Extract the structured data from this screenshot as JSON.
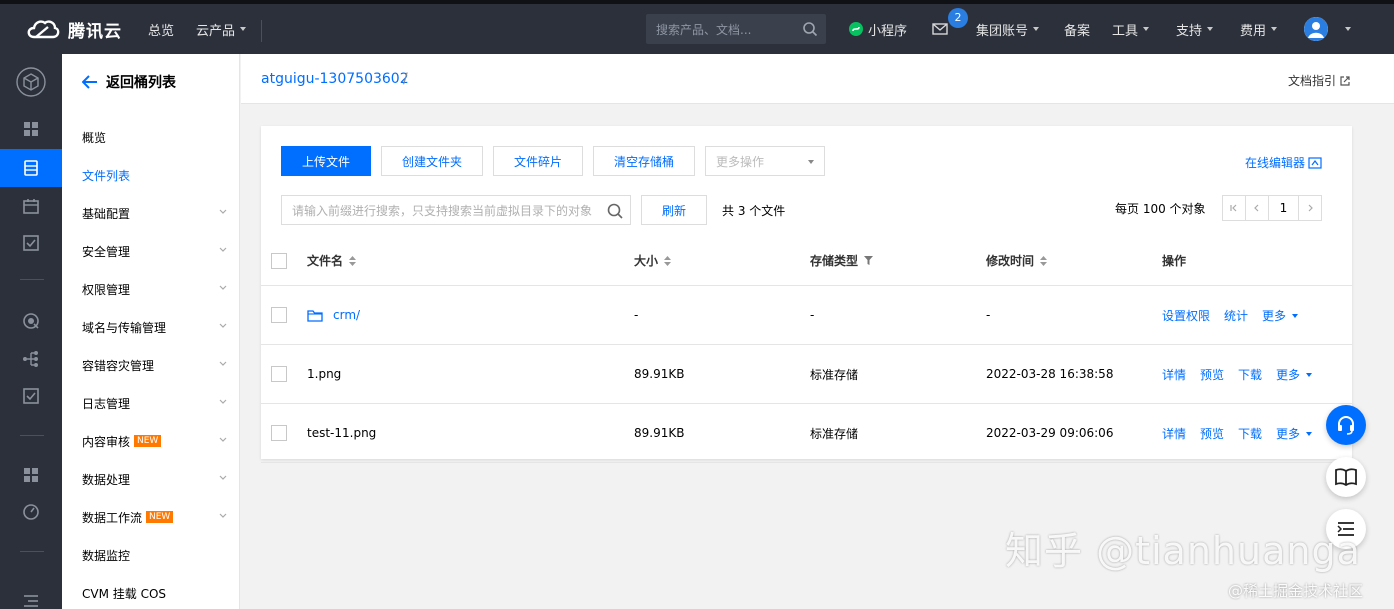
{
  "header": {
    "brand": "腾讯云",
    "nav": [
      {
        "label": "总览",
        "has_caret": false
      },
      {
        "label": "云产品",
        "has_caret": true
      }
    ],
    "search_placeholder": "搜索产品、文档...",
    "mini_program": "小程序",
    "mail_count": "2",
    "right_nav": [
      {
        "label": "集团账号",
        "has_caret": true
      },
      {
        "label": "备案",
        "has_caret": false
      },
      {
        "label": "工具",
        "has_caret": true
      },
      {
        "label": "支持",
        "has_caret": true
      },
      {
        "label": "费用",
        "has_caret": true
      }
    ]
  },
  "rail": {
    "icons": [
      "cube-icon",
      "grid-icon",
      "storage-icon",
      "calendar-icon",
      "checklist-icon",
      "security-icon",
      "tree-icon",
      "check-square-icon",
      "dashboard-icon",
      "gauge-icon",
      "menu-icon"
    ],
    "active": "storage-icon"
  },
  "subnav": {
    "back_label": "返回桶列表",
    "items": [
      {
        "label": "概览",
        "active": false,
        "expandable": false,
        "new": false
      },
      {
        "label": "文件列表",
        "active": true,
        "expandable": false,
        "new": false
      },
      {
        "label": "基础配置",
        "active": false,
        "expandable": true,
        "new": false
      },
      {
        "label": "安全管理",
        "active": false,
        "expandable": true,
        "new": false
      },
      {
        "label": "权限管理",
        "active": false,
        "expandable": true,
        "new": false
      },
      {
        "label": "域名与传输管理",
        "active": false,
        "expandable": true,
        "new": false
      },
      {
        "label": "容错容灾管理",
        "active": false,
        "expandable": true,
        "new": false
      },
      {
        "label": "日志管理",
        "active": false,
        "expandable": true,
        "new": false
      },
      {
        "label": "内容审核",
        "active": false,
        "expandable": true,
        "new": true
      },
      {
        "label": "数据处理",
        "active": false,
        "expandable": true,
        "new": false
      },
      {
        "label": "数据工作流",
        "active": false,
        "expandable": true,
        "new": true
      },
      {
        "label": "数据监控",
        "active": false,
        "expandable": false,
        "new": false
      },
      {
        "label": "CVM 挂载 COS",
        "active": false,
        "expandable": false,
        "new": false
      }
    ],
    "new_tag": "NEW"
  },
  "breadcrumb": {
    "bucket": "atguigu-1307503602",
    "separator": "/",
    "doc_link": "文档指引"
  },
  "toolbar": {
    "upload": "上传文件",
    "create_folder": "创建文件夹",
    "fragments": "文件碎片",
    "clear_bucket": "清空存储桶",
    "more_ops": "更多操作",
    "online_editor": "在线编辑器",
    "search_placeholder": "请输入前缀进行搜索，只支持搜索当前虚拟目录下的对象",
    "refresh": "刷新",
    "file_count": "共 3 个文件",
    "per_page": "每页 100 个对象",
    "page": "1"
  },
  "table": {
    "columns": {
      "name": "文件名",
      "size": "大小",
      "storage": "存储类型",
      "modified": "修改时间",
      "actions": "操作"
    },
    "rows": [
      {
        "name": "crm/",
        "is_folder": true,
        "size": "-",
        "storage": "-",
        "modified": "-",
        "actions": [
          "设置权限",
          "统计",
          "更多"
        ]
      },
      {
        "name": "1.png",
        "is_folder": false,
        "size": "89.91KB",
        "storage": "标准存储",
        "modified": "2022-03-28 16:38:58",
        "actions": [
          "详情",
          "预览",
          "下载",
          "更多"
        ]
      },
      {
        "name": "test-11.png",
        "is_folder": false,
        "size": "89.91KB",
        "storage": "标准存储",
        "modified": "2022-03-29 09:06:06",
        "actions": [
          "详情",
          "预览",
          "下载",
          "更多"
        ]
      }
    ]
  },
  "watermarks": {
    "zhihu": "知乎 @tianhuanga",
    "juejin": "@稀土掘金技术社区"
  }
}
